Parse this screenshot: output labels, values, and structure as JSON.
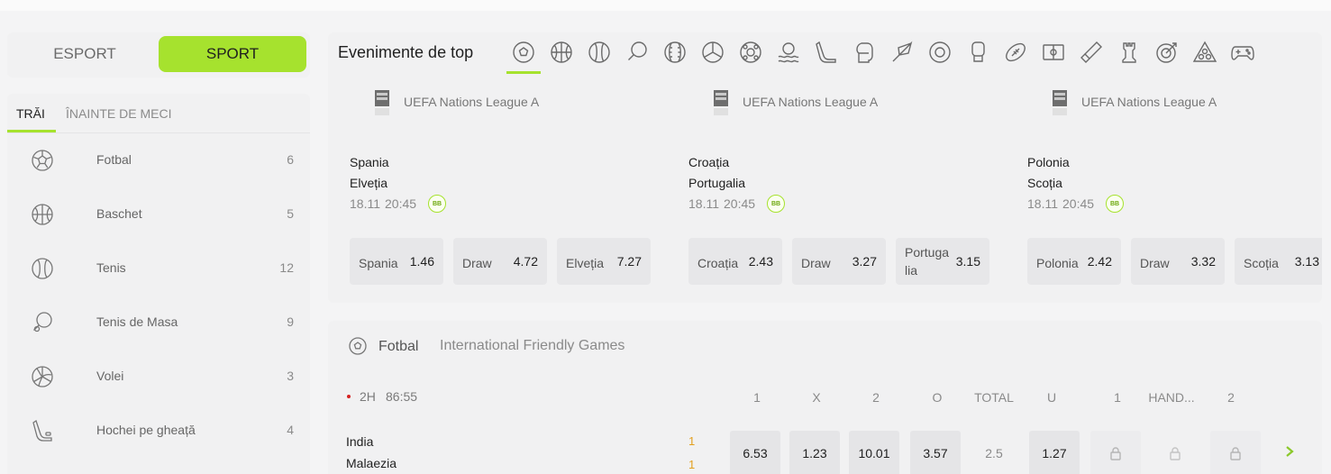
{
  "mode": {
    "esport": "ESPORT",
    "sport": "SPORT",
    "active": "SPORT"
  },
  "sidebar": {
    "tabs": {
      "live": "TRĂI",
      "prematch": "ÎNAINTE DE MECI"
    },
    "items": [
      {
        "label": "Fotbal",
        "count": "6",
        "icon": "soccer-ball-icon"
      },
      {
        "label": "Baschet",
        "count": "5",
        "icon": "basketball-icon"
      },
      {
        "label": "Tenis",
        "count": "12",
        "icon": "tennis-ball-icon"
      },
      {
        "label": "Tenis de Masa",
        "count": "9",
        "icon": "table-tennis-icon"
      },
      {
        "label": "Volei",
        "count": "3",
        "icon": "volleyball-icon"
      },
      {
        "label": "Hochei pe gheață",
        "count": "4",
        "icon": "ice-hockey-icon"
      }
    ]
  },
  "top_events": {
    "title": "Evenimente de top",
    "sport_icons": [
      "soccer-ball-icon",
      "basketball-icon",
      "tennis-ball-icon",
      "table-tennis-icon",
      "baseball-icon",
      "volleyball-icon",
      "futsal-icon",
      "water-polo-icon",
      "ice-hockey-icon",
      "boxing-glove-icon",
      "badminton-icon",
      "snooker-icon",
      "mma-glove-icon",
      "american-football-icon",
      "floorball-icon",
      "cricket-icon",
      "chess-rook-icon",
      "darts-icon",
      "billiards-icon",
      "esports-gamepad-icon"
    ],
    "events": [
      {
        "league": "UEFA Nations League A",
        "home": "Spania",
        "away": "Elveția",
        "date": "18.11",
        "time": "20:45",
        "badge": "BB",
        "odds": [
          {
            "name": "Spania",
            "value": "1.46"
          },
          {
            "name": "Draw",
            "value": "4.72"
          },
          {
            "name": "Elveția",
            "value": "7.27"
          }
        ]
      },
      {
        "league": "UEFA Nations League A",
        "home": "Croația",
        "away": "Portugalia",
        "date": "18.11",
        "time": "20:45",
        "badge": "BB",
        "odds": [
          {
            "name": "Croația",
            "value": "2.43"
          },
          {
            "name": "Draw",
            "value": "3.27"
          },
          {
            "name": "Portugalia",
            "value": "3.15"
          }
        ]
      },
      {
        "league": "UEFA Nations League A",
        "home": "Polonia",
        "away": "Scoția",
        "date": "18.11",
        "time": "20:45",
        "badge": "BB",
        "odds": [
          {
            "name": "Polonia",
            "value": "2.42"
          },
          {
            "name": "Draw",
            "value": "3.32"
          },
          {
            "name": "Scoția",
            "value": "3.13"
          }
        ]
      }
    ]
  },
  "match_list": {
    "sport": "Fotbal",
    "competition": "International Friendly Games",
    "headers": [
      "1",
      "X",
      "2",
      "O",
      "TOTAL",
      "U",
      "1",
      "HAND...",
      "2"
    ],
    "match": {
      "period": "2H",
      "clock": "86:55",
      "home": "India",
      "away": "Malaezia",
      "home_score": "1",
      "away_score": "1",
      "odds": [
        "6.53",
        "1.23",
        "10.01",
        "3.57",
        "2.5",
        "1.27"
      ],
      "handicap_locked": true
    }
  },
  "colors": {
    "accent": "#a6e22e",
    "live": "#d52222",
    "score": "#e3a020",
    "panel": "#f1f1f2"
  }
}
